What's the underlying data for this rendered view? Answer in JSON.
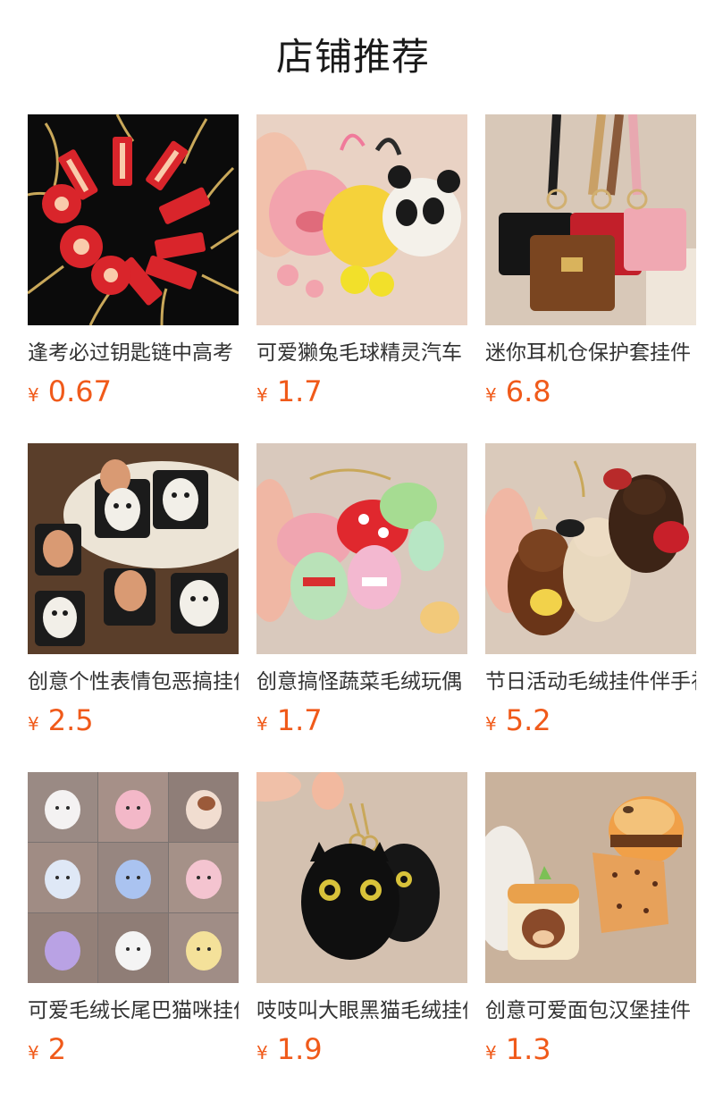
{
  "page": {
    "title": "店铺推荐",
    "currency_symbol": "¥",
    "price_color": "#f05a1a"
  },
  "products": [
    {
      "title": "逢考必过钥匙链中高考",
      "price": "0.67",
      "image": "red-charm-keychains",
      "bg": "#0b0b0b"
    },
    {
      "title": "可爱獭兔毛球精灵汽车",
      "price": "1.7",
      "image": "fluffy-pompom-dolls",
      "bg": "#e9d2c4"
    },
    {
      "title": "迷你耳机仓保护套挂件",
      "price": "6.8",
      "image": "mini-handbag-charms",
      "bg": "#d8c8b8"
    },
    {
      "title": "创意个性表情包恶搞挂件",
      "price": "2.5",
      "image": "meme-face-pouches",
      "bg": "#5a3e2a"
    },
    {
      "title": "创意搞怪蔬菜毛绒玩偶",
      "price": "1.7",
      "image": "vegetable-plush-dolls",
      "bg": "#d9c9bd"
    },
    {
      "title": "节日活动毛绒挂件伴手礼",
      "price": "5.2",
      "image": "teddy-bear-keychains",
      "bg": "#dacabb"
    },
    {
      "title": "可爱毛绒长尾巴猫咪挂件",
      "price": "2",
      "image": "long-tail-cat-plush-grid",
      "bg": "#7a7270"
    },
    {
      "title": "吱吱叫大眼黑猫毛绒挂件",
      "price": "1.9",
      "image": "black-cat-plush",
      "bg": "#d4c1b0"
    },
    {
      "title": "创意可爱面包汉堡挂件",
      "price": "1.3",
      "image": "bread-burger-charms",
      "bg": "#c9b29c"
    }
  ]
}
